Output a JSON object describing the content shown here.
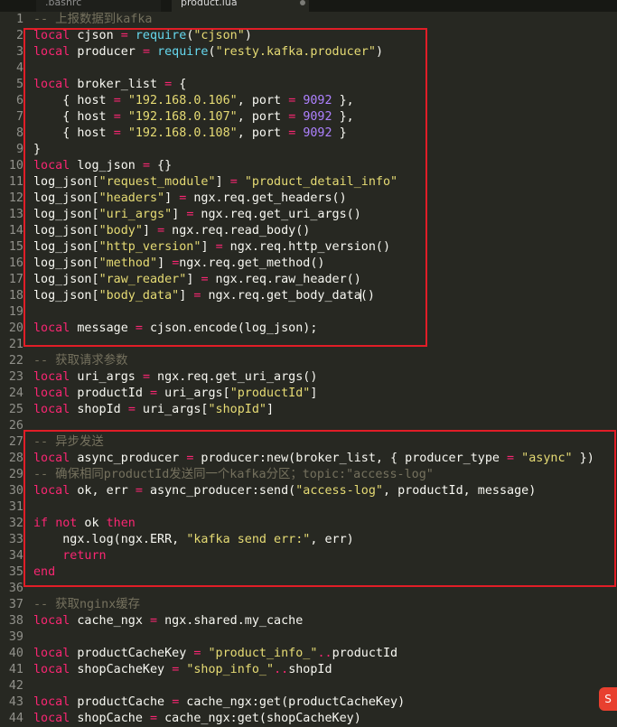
{
  "tabs": [
    {
      "label": ".bashrc",
      "active": false
    },
    {
      "label": "product.lua",
      "active": true
    }
  ],
  "lines": [
    [
      [
        "c",
        "-- 上报数据到kafka"
      ]
    ],
    [
      [
        "k",
        "local"
      ],
      [
        "t",
        " cjson "
      ],
      [
        "k",
        "="
      ],
      [
        "t",
        " "
      ],
      [
        "f",
        "require"
      ],
      [
        "t",
        "("
      ],
      [
        "s",
        "\"cjson\""
      ],
      [
        "t",
        ")"
      ]
    ],
    [
      [
        "k",
        "local"
      ],
      [
        "t",
        " producer "
      ],
      [
        "k",
        "="
      ],
      [
        "t",
        " "
      ],
      [
        "f",
        "require"
      ],
      [
        "t",
        "("
      ],
      [
        "s",
        "\"resty.kafka.producer\""
      ],
      [
        "t",
        ")"
      ]
    ],
    [],
    [
      [
        "k",
        "local"
      ],
      [
        "t",
        " broker_list "
      ],
      [
        "k",
        "="
      ],
      [
        "t",
        " {"
      ]
    ],
    [
      [
        "t",
        "    { host "
      ],
      [
        "k",
        "="
      ],
      [
        "t",
        " "
      ],
      [
        "s",
        "\"192.168.0.106\""
      ],
      [
        "t",
        ", port "
      ],
      [
        "k",
        "="
      ],
      [
        "t",
        " "
      ],
      [
        "n",
        "9092"
      ],
      [
        "t",
        " },"
      ]
    ],
    [
      [
        "t",
        "    { host "
      ],
      [
        "k",
        "="
      ],
      [
        "t",
        " "
      ],
      [
        "s",
        "\"192.168.0.107\""
      ],
      [
        "t",
        ", port "
      ],
      [
        "k",
        "="
      ],
      [
        "t",
        " "
      ],
      [
        "n",
        "9092"
      ],
      [
        "t",
        " },"
      ]
    ],
    [
      [
        "t",
        "    { host "
      ],
      [
        "k",
        "="
      ],
      [
        "t",
        " "
      ],
      [
        "s",
        "\"192.168.0.108\""
      ],
      [
        "t",
        ", port "
      ],
      [
        "k",
        "="
      ],
      [
        "t",
        " "
      ],
      [
        "n",
        "9092"
      ],
      [
        "t",
        " }"
      ]
    ],
    [
      [
        "t",
        "}"
      ]
    ],
    [
      [
        "k",
        "local"
      ],
      [
        "t",
        " log_json "
      ],
      [
        "k",
        "="
      ],
      [
        "t",
        " {}"
      ]
    ],
    [
      [
        "t",
        "log_json["
      ],
      [
        "s",
        "\"request_module\""
      ],
      [
        "t",
        "] "
      ],
      [
        "k",
        "="
      ],
      [
        "t",
        " "
      ],
      [
        "s",
        "\"product_detail_info\""
      ]
    ],
    [
      [
        "t",
        "log_json["
      ],
      [
        "s",
        "\"headers\""
      ],
      [
        "t",
        "] "
      ],
      [
        "k",
        "="
      ],
      [
        "t",
        " ngx.req.get_headers()"
      ]
    ],
    [
      [
        "t",
        "log_json["
      ],
      [
        "s",
        "\"uri_args\""
      ],
      [
        "t",
        "] "
      ],
      [
        "k",
        "="
      ],
      [
        "t",
        " ngx.req.get_uri_args()"
      ]
    ],
    [
      [
        "t",
        "log_json["
      ],
      [
        "s",
        "\"body\""
      ],
      [
        "t",
        "] "
      ],
      [
        "k",
        "="
      ],
      [
        "t",
        " ngx.req.read_body()"
      ]
    ],
    [
      [
        "t",
        "log_json["
      ],
      [
        "s",
        "\"http_version\""
      ],
      [
        "t",
        "] "
      ],
      [
        "k",
        "="
      ],
      [
        "t",
        " ngx.req.http_version()"
      ]
    ],
    [
      [
        "t",
        "log_json["
      ],
      [
        "s",
        "\"method\""
      ],
      [
        "t",
        "] "
      ],
      [
        "k",
        "="
      ],
      [
        "t",
        "ngx.req.get_method()"
      ]
    ],
    [
      [
        "t",
        "log_json["
      ],
      [
        "s",
        "\"raw_reader\""
      ],
      [
        "t",
        "] "
      ],
      [
        "k",
        "="
      ],
      [
        "t",
        " ngx.req.raw_header()"
      ]
    ],
    [
      [
        "t",
        "log_json["
      ],
      [
        "s",
        "\"body_data\""
      ],
      [
        "t",
        "] "
      ],
      [
        "k",
        "="
      ],
      [
        "t",
        " ngx.req.get_body_data"
      ],
      [
        "caret",
        ""
      ],
      [
        "t",
        "()"
      ]
    ],
    [],
    [
      [
        "k",
        "local"
      ],
      [
        "t",
        " message "
      ],
      [
        "k",
        "="
      ],
      [
        "t",
        " cjson.encode(log_json);"
      ]
    ],
    [],
    [
      [
        "c",
        "-- 获取请求参数"
      ]
    ],
    [
      [
        "k",
        "local"
      ],
      [
        "t",
        " uri_args "
      ],
      [
        "k",
        "="
      ],
      [
        "t",
        " ngx.req.get_uri_args()"
      ]
    ],
    [
      [
        "k",
        "local"
      ],
      [
        "t",
        " productId "
      ],
      [
        "k",
        "="
      ],
      [
        "t",
        " uri_args["
      ],
      [
        "s",
        "\"productId\""
      ],
      [
        "t",
        "]"
      ]
    ],
    [
      [
        "k",
        "local"
      ],
      [
        "t",
        " shopId "
      ],
      [
        "k",
        "="
      ],
      [
        "t",
        " uri_args["
      ],
      [
        "s",
        "\"shopId\""
      ],
      [
        "t",
        "]"
      ]
    ],
    [],
    [
      [
        "c",
        "-- 异步发送"
      ]
    ],
    [
      [
        "k",
        "local"
      ],
      [
        "t",
        " async_producer "
      ],
      [
        "k",
        "="
      ],
      [
        "t",
        " producer:new(broker_list, { producer_type "
      ],
      [
        "k",
        "="
      ],
      [
        "t",
        " "
      ],
      [
        "s",
        "\"async\""
      ],
      [
        "t",
        " })"
      ]
    ],
    [
      [
        "c",
        "-- 确保相同productId发送同一个kafka分区；topic:\"access-log\""
      ]
    ],
    [
      [
        "k",
        "local"
      ],
      [
        "t",
        " ok, err "
      ],
      [
        "k",
        "="
      ],
      [
        "t",
        " async_producer:send("
      ],
      [
        "s",
        "\"access-log\""
      ],
      [
        "t",
        ", productId, message)"
      ]
    ],
    [],
    [
      [
        "k",
        "if"
      ],
      [
        "t",
        " "
      ],
      [
        "k",
        "not"
      ],
      [
        "t",
        " ok "
      ],
      [
        "k",
        "then"
      ]
    ],
    [
      [
        "t",
        "    ngx.log(ngx.ERR, "
      ],
      [
        "s",
        "\"kafka send err:\""
      ],
      [
        "t",
        ", err)"
      ]
    ],
    [
      [
        "t",
        "    "
      ],
      [
        "k",
        "return"
      ]
    ],
    [
      [
        "k",
        "end"
      ]
    ],
    [],
    [
      [
        "c",
        "-- 获取nginx缓存"
      ]
    ],
    [
      [
        "k",
        "local"
      ],
      [
        "t",
        " cache_ngx "
      ],
      [
        "k",
        "="
      ],
      [
        "t",
        " ngx.shared.my_cache"
      ]
    ],
    [],
    [
      [
        "k",
        "local"
      ],
      [
        "t",
        " productCacheKey "
      ],
      [
        "k",
        "="
      ],
      [
        "t",
        " "
      ],
      [
        "s",
        "\"product_info_\""
      ],
      [
        "k",
        ".."
      ],
      [
        "t",
        "productId"
      ]
    ],
    [
      [
        "k",
        "local"
      ],
      [
        "t",
        " shopCacheKey "
      ],
      [
        "k",
        "="
      ],
      [
        "t",
        " "
      ],
      [
        "s",
        "\"shop_info_\""
      ],
      [
        "k",
        ".."
      ],
      [
        "t",
        "shopId"
      ]
    ],
    [],
    [
      [
        "k",
        "local"
      ],
      [
        "t",
        " productCache "
      ],
      [
        "k",
        "="
      ],
      [
        "t",
        " cache_ngx:get(productCacheKey)"
      ]
    ],
    [
      [
        "k",
        "local"
      ],
      [
        "t",
        " shopCache "
      ],
      [
        "k",
        "="
      ],
      [
        "t",
        " cache_ngx:get(shopCacheKey)"
      ]
    ]
  ],
  "highlight_ranges": [
    [
      2,
      20
    ],
    [
      26,
      35
    ]
  ],
  "colors": {
    "background": "#272822",
    "keyword": "#f92672",
    "builtin": "#66d9ef",
    "string": "#e6db74",
    "number": "#ae81ff",
    "comment": "#75715e",
    "highlight_box": "#e11d27"
  },
  "corner_icon": "s5-logo-icon"
}
